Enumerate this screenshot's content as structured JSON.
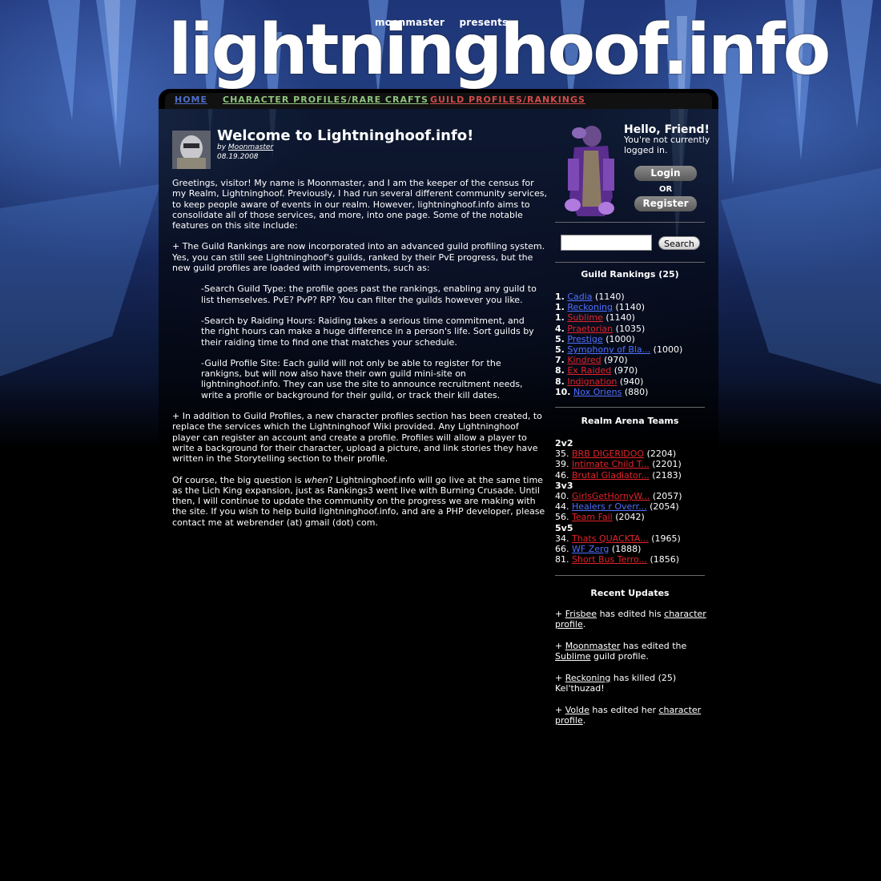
{
  "colors": {
    "nav_home": "#4f6ec7",
    "nav_chars": "#8fc47e",
    "nav_guilds": "#d24b4b",
    "link_blue": "#4f70ff",
    "link_red": "#e2242a"
  },
  "header": {
    "presents": "moonmaster presents",
    "title": "lightninghoof.info"
  },
  "nav": {
    "home": "HOME",
    "characters": "CHARACTER PROFILES/RARE CRAFTS",
    "guilds": "GUILD PROFILES/RANKINGS"
  },
  "article": {
    "title": "Welcome to Lightninghoof.info!",
    "by_prefix": "by",
    "author": "Moonmaster",
    "date": "08.19.2008",
    "paragraphs": [
      "Greetings, visitor!  My name is Moonmaster, and I am the keeper of the census for my Realm, Lightninghoof.  Previously, I had run several different community services, to keep people aware of events in our realm.  However, lightninghoof.info aims to consolidate all of those services, and more, into one page.  Some of the notable features on this site include:",
      "+ The Guild Rankings are now incorporated into an advanced guild profiling system.  Yes, you can still see Lightninghoof's guilds, ranked by their PvE progress, but the new guild profiles are loaded with improvements, such as:",
      "-Search Guild Type: the profile goes past the rankings, enabling any guild to list themselves. PvE? PvP? RP? You can filter the guilds however you like.",
      "-Search by Raiding Hours: Raiding takes a serious time commitment, and the right hours can make a huge difference in a person's life.  Sort guilds by their raiding time to find one that matches your schedule.",
      "-Guild Profile Site: Each guild will not only be able to register for the rankigns, but will now also have their own guild mini-site on lightninghoof.info.  They can use the site to announce recruitment needs, write a profile or background for their guild, or track their kill dates.",
      "+ In addition to Guild Profiles, a new character profiles section has been created, to replace the services which the Lightninghoof Wiki provided.  Any Lightninghoof player can register an account and create a profile.  Profiles will allow a player to write a background for their character, upload a picture, and link stories they have written in the Storytelling section to their profile."
    ],
    "last_pre": "Of course, the big question is ",
    "last_em": "when",
    "last_post": "?  Lightninghoof.info will go live at the same time as the Lich King expansion, just as Rankings3 went live with Burning Crusade. Until then, I will continue to update the community on the progress we are making with the site.  If you wish to help build lightninghoof.info, and are a PHP developer, please contact me at webrender (at) gmail (dot) com."
  },
  "login": {
    "hello": "Hello, Friend!",
    "status": "You're not currently logged in.",
    "login_button": "Login",
    "or": "OR",
    "register_button": "Register"
  },
  "search": {
    "placeholder": "",
    "button": "Search"
  },
  "guild_rankings": {
    "heading": "Guild Rankings (25)",
    "rows": [
      {
        "rank": "1.",
        "name": "Cadia",
        "score": "(1140)",
        "color": "blue"
      },
      {
        "rank": "1.",
        "name": "Reckoning",
        "score": "(1140)",
        "color": "blue"
      },
      {
        "rank": "1.",
        "name": "Sublime",
        "score": "(1140)",
        "color": "red"
      },
      {
        "rank": "4.",
        "name": "Praetorian",
        "score": "(1035)",
        "color": "red"
      },
      {
        "rank": "5.",
        "name": "Prestige",
        "score": "(1000)",
        "color": "blue"
      },
      {
        "rank": "5.",
        "name": "Symphony of Bla...",
        "score": "(1000)",
        "color": "blue"
      },
      {
        "rank": "7.",
        "name": "Kindred",
        "score": "(970)",
        "color": "red"
      },
      {
        "rank": "8.",
        "name": "Ex Raided",
        "score": "(970)",
        "color": "red"
      },
      {
        "rank": "8.",
        "name": "Indignation",
        "score": "(940)",
        "color": "red"
      },
      {
        "rank": "10.",
        "name": "Nox Oriens",
        "score": "(880)",
        "color": "blue"
      }
    ]
  },
  "arena": {
    "heading": "Realm Arena Teams",
    "brackets": [
      {
        "label": "2v2",
        "teams": [
          {
            "rank": "35.",
            "name": "BRB DIGERIDOO",
            "score": "(2204)",
            "color": "red"
          },
          {
            "rank": "39.",
            "name": "Intimate Child T...",
            "score": "(2201)",
            "color": "red"
          },
          {
            "rank": "46.",
            "name": "Brutal Gladiator...",
            "score": "(2183)",
            "color": "red"
          }
        ]
      },
      {
        "label": "3v3",
        "teams": [
          {
            "rank": "40.",
            "name": "GirlsGetHornyW...",
            "score": "(2057)",
            "color": "red"
          },
          {
            "rank": "44.",
            "name": "Healers r Overr...",
            "score": "(2054)",
            "color": "blue"
          },
          {
            "rank": "56.",
            "name": "Team Fail",
            "score": "(2042)",
            "color": "red"
          }
        ]
      },
      {
        "label": "5v5",
        "teams": [
          {
            "rank": "34.",
            "name": "Thats QUACKTA...",
            "score": "(1965)",
            "color": "red"
          },
          {
            "rank": "66.",
            "name": "WF Zerg",
            "score": "(1888)",
            "color": "blue"
          },
          {
            "rank": "81.",
            "name": "Short Bus Terro...",
            "score": "(1856)",
            "color": "red"
          }
        ]
      }
    ]
  },
  "updates": {
    "heading": "Recent Updates",
    "items": [
      {
        "pre": "+ ",
        "who": "Frisbee",
        "mid": " has edited his ",
        "link": "character profile",
        "post": "."
      },
      {
        "pre": "+ ",
        "who": "Moonmaster",
        "mid": " has edited the ",
        "link": "Sublime",
        "post": " guild profile."
      },
      {
        "pre": "+ ",
        "who": "Reckoning",
        "mid": " has killed (25) Kel'thuzad!",
        "link": "",
        "post": ""
      },
      {
        "pre": "+ ",
        "who": "Volde",
        "mid": " has edited her ",
        "link": "character profile",
        "post": "."
      }
    ]
  }
}
